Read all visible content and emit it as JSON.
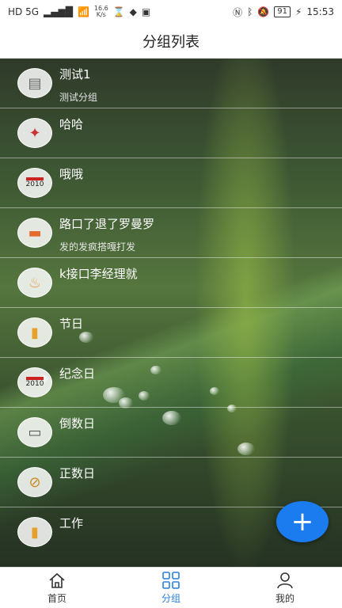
{
  "status_bar": {
    "left_badges": "HD 5G",
    "speed_value": "16.6",
    "speed_unit": "K/s",
    "battery": "91",
    "time": "15:53"
  },
  "header": {
    "title": "分组列表"
  },
  "groups": [
    {
      "name": "测试1",
      "sub": "测试分组",
      "icon": "document-icon"
    },
    {
      "name": "哈哈",
      "sub": "",
      "icon": "people-icon"
    },
    {
      "name": "哦哦",
      "sub": "",
      "icon": "calendar-icon",
      "icon_text": "2010"
    },
    {
      "name": "路口了退了罗曼罗",
      "sub": "发的发疯搭嘎打发",
      "icon": "card-icon"
    },
    {
      "name": "k接口李经理就",
      "sub": "",
      "icon": "candle-icon"
    },
    {
      "name": "节日",
      "sub": "",
      "icon": "notebook-icon"
    },
    {
      "name": "纪念日",
      "sub": "",
      "icon": "calendar-icon",
      "icon_text": "2010"
    },
    {
      "name": "倒数日",
      "sub": "",
      "icon": "board-icon"
    },
    {
      "name": "正数日",
      "sub": "",
      "icon": "paperclip-icon"
    },
    {
      "name": "工作",
      "sub": "",
      "icon": "notebook-icon"
    }
  ],
  "fab": {
    "symbol": "+"
  },
  "tabbar": [
    {
      "label": "首页",
      "icon": "home-icon",
      "active": false
    },
    {
      "label": "分组",
      "icon": "grid-icon",
      "active": true
    },
    {
      "label": "我的",
      "icon": "person-icon",
      "active": false
    }
  ],
  "colors": {
    "accent": "#1b7cf0",
    "tab_active": "#2a7fd8"
  }
}
